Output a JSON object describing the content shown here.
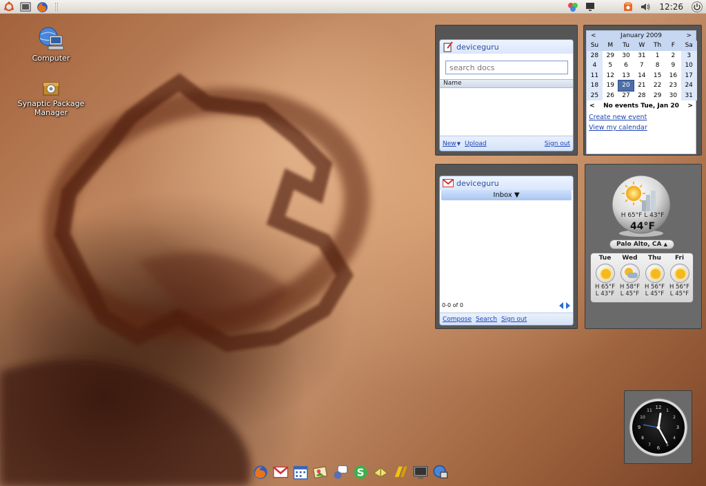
{
  "colors": {
    "accent": "#2a4f9e",
    "link": "#1d44b8",
    "calendar_today": "#4d6ea8"
  },
  "top_panel": {
    "left_icons": [
      "ubuntu-logo-icon",
      "screenshot-icon",
      "firefox-icon"
    ],
    "right_icons": [
      "network-manager-icon",
      "display-icon",
      "update-notifier-icon",
      "volume-icon"
    ],
    "time": "12:26"
  },
  "desktop_icons": [
    {
      "label": "Computer",
      "icon": "computer-icon"
    },
    {
      "label": "Synaptic Package Manager",
      "icon": "synaptic-icon"
    }
  ],
  "docs_gadget": {
    "user": "deviceguru",
    "search_placeholder": "search docs",
    "column": "Name",
    "new_label": "New",
    "upload_label": "Upload",
    "signout_label": "Sign out"
  },
  "calendar_gadget": {
    "month": "January 2009",
    "prev": "<",
    "next": ">",
    "weekdays": [
      "Su",
      "M",
      "Tu",
      "W",
      "Th",
      "F",
      "Sa"
    ],
    "weeks": [
      [
        "28",
        "29",
        "30",
        "31",
        "1",
        "2",
        "3"
      ],
      [
        "4",
        "5",
        "6",
        "7",
        "8",
        "9",
        "10"
      ],
      [
        "11",
        "12",
        "13",
        "14",
        "15",
        "16",
        "17"
      ],
      [
        "18",
        "19",
        "20",
        "21",
        "22",
        "23",
        "24"
      ],
      [
        "25",
        "26",
        "27",
        "28",
        "29",
        "30",
        "31"
      ]
    ],
    "today": "20",
    "event_text": "No events Tue, Jan 20",
    "create_event": "Create new event",
    "view_calendar": "View my calendar"
  },
  "gmail_gadget": {
    "user": "deviceguru",
    "folder": "Inbox ▼",
    "count": "0-0 of 0",
    "compose": "Compose",
    "search": "Search",
    "signout": "Sign out"
  },
  "weather_gadget": {
    "current_hilo": "H 65°F L 43°F",
    "current_temp": "44°F",
    "city": "Palo Alto, CA",
    "forecast": [
      {
        "day": "Tue",
        "hi": "H 65°F",
        "lo": "L 43°F",
        "icon": "sunny-icon"
      },
      {
        "day": "Wed",
        "hi": "H 58°F",
        "lo": "L 45°F",
        "icon": "partly-cloudy-icon"
      },
      {
        "day": "Thu",
        "hi": "H 56°F",
        "lo": "L 45°F",
        "icon": "sunny-icon"
      },
      {
        "day": "Fri",
        "hi": "H 56°F",
        "lo": "L 45°F",
        "icon": "sunny-icon"
      }
    ]
  },
  "clock_gadget": {
    "numerals": [
      "12",
      "1",
      "2",
      "3",
      "4",
      "5",
      "6",
      "7",
      "8",
      "9",
      "10",
      "11"
    ]
  },
  "dock_icons": [
    "firefox-icon",
    "gmail-icon",
    "calendar-icon",
    "photos-icon",
    "chat-icon",
    "skype-icon",
    "tomboy-icon",
    "office-icon",
    "monitor-icon",
    "network-icon"
  ]
}
